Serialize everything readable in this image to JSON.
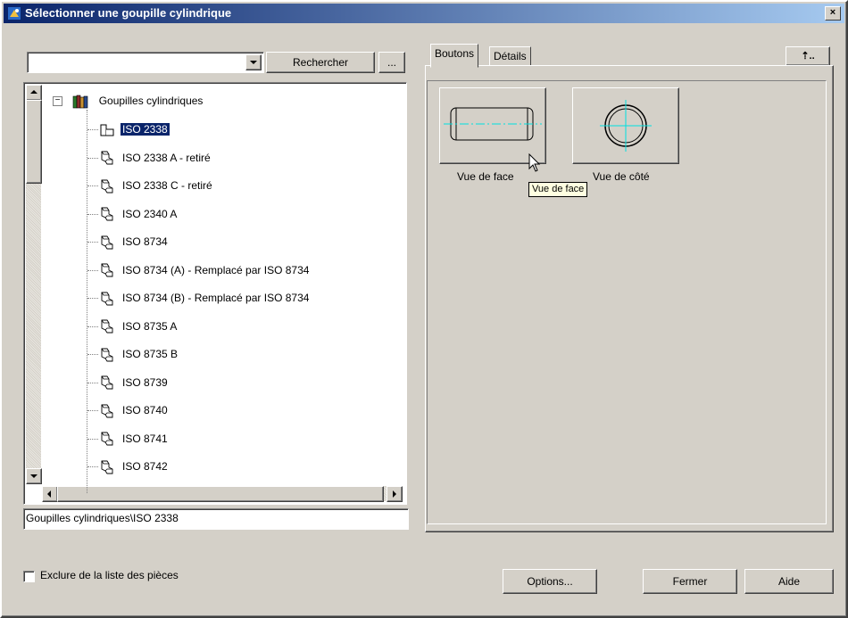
{
  "window": {
    "title": "Sélectionner une goupille cylindrique",
    "close_label": "×"
  },
  "search": {
    "value": "",
    "button_label": "Rechercher",
    "browse_label": "..."
  },
  "tree": {
    "root_label": "Goupilles cylindriques",
    "items": [
      {
        "label": "ISO 2338",
        "selected": true
      },
      {
        "label": "ISO 2338 A - retiré"
      },
      {
        "label": "ISO 2338 C - retiré"
      },
      {
        "label": "ISO 2340 A"
      },
      {
        "label": "ISO 8734"
      },
      {
        "label": "ISO 8734 (A) - Remplacé par ISO 8734"
      },
      {
        "label": "ISO 8734 (B) - Remplacé par ISO 8734"
      },
      {
        "label": "ISO 8735 A"
      },
      {
        "label": "ISO 8735 B"
      },
      {
        "label": "ISO 8739"
      },
      {
        "label": "ISO 8740"
      },
      {
        "label": "ISO 8741"
      },
      {
        "label": "ISO 8742"
      }
    ]
  },
  "path": "Goupilles cylindriques\\ISO 2338",
  "tabs": [
    {
      "label": "Boutons"
    },
    {
      "label": "Détails"
    }
  ],
  "up_label": "⇡..",
  "views": [
    {
      "label": "Vue de face"
    },
    {
      "label": "Vue de côté"
    }
  ],
  "tooltip": "Vue de face",
  "footer": {
    "exclude_label": "Exclure de la liste des pièces",
    "options_label": "Options...",
    "close_label": "Fermer",
    "help_label": "Aide"
  },
  "colors": {
    "selection": "#0a246a",
    "centerline": "#00e0e0",
    "face": "#d4d0c8"
  }
}
